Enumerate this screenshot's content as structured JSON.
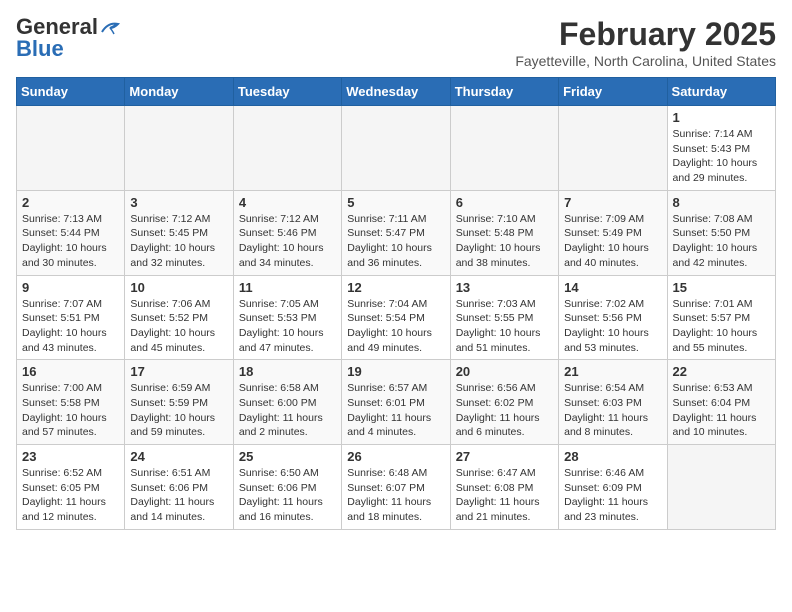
{
  "header": {
    "logo_general": "General",
    "logo_blue": "Blue",
    "month_year": "February 2025",
    "location": "Fayetteville, North Carolina, United States"
  },
  "weekdays": [
    "Sunday",
    "Monday",
    "Tuesday",
    "Wednesday",
    "Thursday",
    "Friday",
    "Saturday"
  ],
  "weeks": [
    [
      {
        "day": "",
        "info": ""
      },
      {
        "day": "",
        "info": ""
      },
      {
        "day": "",
        "info": ""
      },
      {
        "day": "",
        "info": ""
      },
      {
        "day": "",
        "info": ""
      },
      {
        "day": "",
        "info": ""
      },
      {
        "day": "1",
        "info": "Sunrise: 7:14 AM\nSunset: 5:43 PM\nDaylight: 10 hours\nand 29 minutes."
      }
    ],
    [
      {
        "day": "2",
        "info": "Sunrise: 7:13 AM\nSunset: 5:44 PM\nDaylight: 10 hours\nand 30 minutes."
      },
      {
        "day": "3",
        "info": "Sunrise: 7:12 AM\nSunset: 5:45 PM\nDaylight: 10 hours\nand 32 minutes."
      },
      {
        "day": "4",
        "info": "Sunrise: 7:12 AM\nSunset: 5:46 PM\nDaylight: 10 hours\nand 34 minutes."
      },
      {
        "day": "5",
        "info": "Sunrise: 7:11 AM\nSunset: 5:47 PM\nDaylight: 10 hours\nand 36 minutes."
      },
      {
        "day": "6",
        "info": "Sunrise: 7:10 AM\nSunset: 5:48 PM\nDaylight: 10 hours\nand 38 minutes."
      },
      {
        "day": "7",
        "info": "Sunrise: 7:09 AM\nSunset: 5:49 PM\nDaylight: 10 hours\nand 40 minutes."
      },
      {
        "day": "8",
        "info": "Sunrise: 7:08 AM\nSunset: 5:50 PM\nDaylight: 10 hours\nand 42 minutes."
      }
    ],
    [
      {
        "day": "9",
        "info": "Sunrise: 7:07 AM\nSunset: 5:51 PM\nDaylight: 10 hours\nand 43 minutes."
      },
      {
        "day": "10",
        "info": "Sunrise: 7:06 AM\nSunset: 5:52 PM\nDaylight: 10 hours\nand 45 minutes."
      },
      {
        "day": "11",
        "info": "Sunrise: 7:05 AM\nSunset: 5:53 PM\nDaylight: 10 hours\nand 47 minutes."
      },
      {
        "day": "12",
        "info": "Sunrise: 7:04 AM\nSunset: 5:54 PM\nDaylight: 10 hours\nand 49 minutes."
      },
      {
        "day": "13",
        "info": "Sunrise: 7:03 AM\nSunset: 5:55 PM\nDaylight: 10 hours\nand 51 minutes."
      },
      {
        "day": "14",
        "info": "Sunrise: 7:02 AM\nSunset: 5:56 PM\nDaylight: 10 hours\nand 53 minutes."
      },
      {
        "day": "15",
        "info": "Sunrise: 7:01 AM\nSunset: 5:57 PM\nDaylight: 10 hours\nand 55 minutes."
      }
    ],
    [
      {
        "day": "16",
        "info": "Sunrise: 7:00 AM\nSunset: 5:58 PM\nDaylight: 10 hours\nand 57 minutes."
      },
      {
        "day": "17",
        "info": "Sunrise: 6:59 AM\nSunset: 5:59 PM\nDaylight: 10 hours\nand 59 minutes."
      },
      {
        "day": "18",
        "info": "Sunrise: 6:58 AM\nSunset: 6:00 PM\nDaylight: 11 hours\nand 2 minutes."
      },
      {
        "day": "19",
        "info": "Sunrise: 6:57 AM\nSunset: 6:01 PM\nDaylight: 11 hours\nand 4 minutes."
      },
      {
        "day": "20",
        "info": "Sunrise: 6:56 AM\nSunset: 6:02 PM\nDaylight: 11 hours\nand 6 minutes."
      },
      {
        "day": "21",
        "info": "Sunrise: 6:54 AM\nSunset: 6:03 PM\nDaylight: 11 hours\nand 8 minutes."
      },
      {
        "day": "22",
        "info": "Sunrise: 6:53 AM\nSunset: 6:04 PM\nDaylight: 11 hours\nand 10 minutes."
      }
    ],
    [
      {
        "day": "23",
        "info": "Sunrise: 6:52 AM\nSunset: 6:05 PM\nDaylight: 11 hours\nand 12 minutes."
      },
      {
        "day": "24",
        "info": "Sunrise: 6:51 AM\nSunset: 6:06 PM\nDaylight: 11 hours\nand 14 minutes."
      },
      {
        "day": "25",
        "info": "Sunrise: 6:50 AM\nSunset: 6:06 PM\nDaylight: 11 hours\nand 16 minutes."
      },
      {
        "day": "26",
        "info": "Sunrise: 6:48 AM\nSunset: 6:07 PM\nDaylight: 11 hours\nand 18 minutes."
      },
      {
        "day": "27",
        "info": "Sunrise: 6:47 AM\nSunset: 6:08 PM\nDaylight: 11 hours\nand 21 minutes."
      },
      {
        "day": "28",
        "info": "Sunrise: 6:46 AM\nSunset: 6:09 PM\nDaylight: 11 hours\nand 23 minutes."
      },
      {
        "day": "",
        "info": ""
      }
    ]
  ]
}
